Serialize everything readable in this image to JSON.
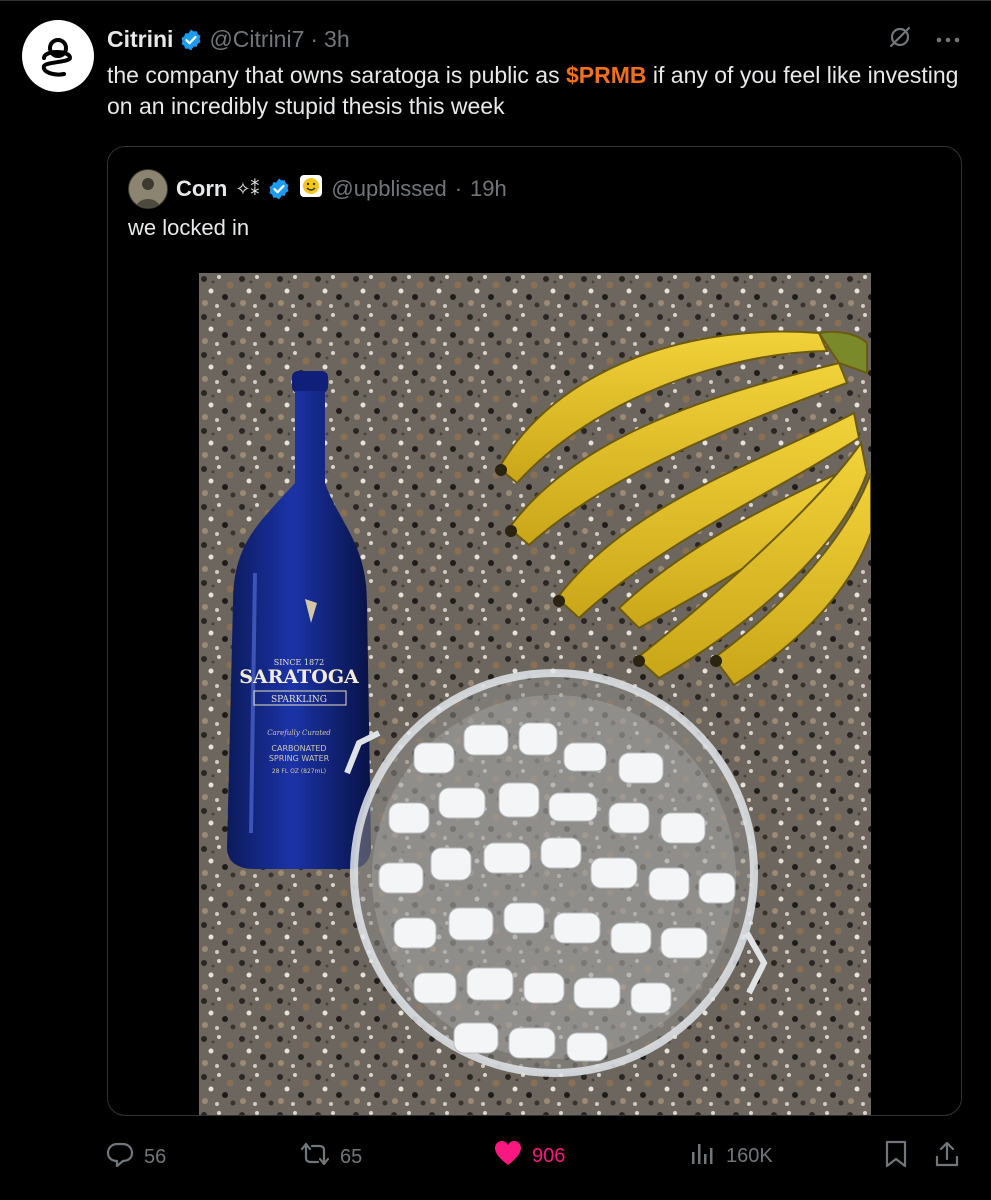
{
  "tweet": {
    "author_name": "Citrini",
    "author_handle": "@Citrini7",
    "separator": "·",
    "time": "3h",
    "text_before": "the company that owns saratoga is public as ",
    "cashtag": "$PRMB",
    "text_after": " if any of you feel like investing on an incredibly stupid thesis this week"
  },
  "quoted": {
    "author_name": "Corn",
    "name_suffix": "✧⁑",
    "author_handle": "@upblissed",
    "separator": "·",
    "time": "19h",
    "text": "we locked in",
    "image": {
      "bottle_lines": [
        "SINCE 1872",
        "SARATOGA",
        "SPARKLING",
        "Carefully Curated",
        "CARBONATED",
        "SPRING WATER",
        "28 FL OZ (827mL)"
      ]
    }
  },
  "actions": {
    "replies": "56",
    "reposts": "65",
    "likes": "906",
    "views": "160K"
  },
  "colors": {
    "background": "#000000",
    "text": "#e7e9ea",
    "muted": "#71767b",
    "verified": "#1d9bf0",
    "cashtag": "#f26f1c",
    "like": "#f91880"
  }
}
